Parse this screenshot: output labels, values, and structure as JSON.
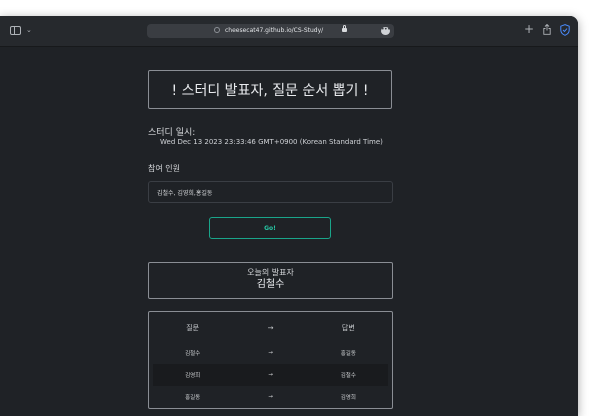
{
  "browser": {
    "url": "cheesecat47.github.io/CS-Study/",
    "more_glyph": "•••",
    "new_tab_glyph": "+",
    "chevron_glyph": "⌄"
  },
  "page": {
    "title": "! 스터디 발표자, 질문 순서 뽑기 !",
    "study_label": "스터디 일시:",
    "study_datetime": "Wed Dec 13 2023 23:33:46 GMT+0900 (Korean Standard Time)",
    "members_label": "참여 인원",
    "members_value": "김철수, 김영희,홍길동",
    "go_label": "Go!",
    "presenter_label": "오늘의 발표자",
    "presenter_name": "김철수"
  },
  "qa_table": {
    "headers": {
      "question": "질문",
      "arrow": "→",
      "answer": "답변"
    },
    "rows": [
      {
        "question": "김철수",
        "arrow": "→",
        "answer": "홍길동"
      },
      {
        "question": "김영희",
        "arrow": "→",
        "answer": "김철수"
      },
      {
        "question": "홍길동",
        "arrow": "→",
        "answer": "김영희"
      }
    ]
  },
  "colors": {
    "background": "#1f2226",
    "go_accent": "#27c6a4",
    "safari_shield": "#4a8cff"
  }
}
